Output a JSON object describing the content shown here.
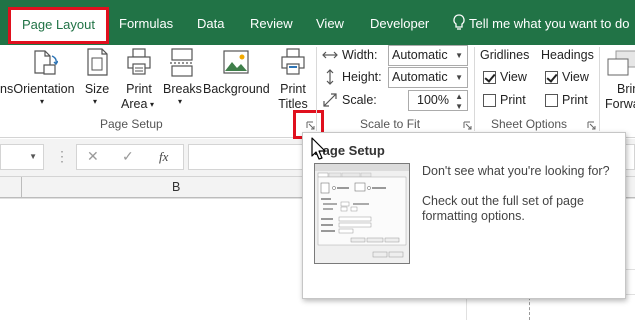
{
  "tabs": {
    "page_layout": "Page Layout",
    "formulas": "Formulas",
    "data": "Data",
    "review": "Review",
    "view": "View",
    "developer": "Developer",
    "tell_me": "Tell me what you want to do"
  },
  "ribbon": {
    "margins_partial": "ns",
    "orientation": "Orientation",
    "size": "Size",
    "print_area_line1": "Print",
    "print_area_line2": "Area",
    "breaks": "Breaks",
    "background": "Background",
    "print_titles_line1": "Print",
    "print_titles_line2": "Titles",
    "page_setup_group": "Page Setup",
    "width_label": "Width:",
    "width_value": "Automatic",
    "height_label": "Height:",
    "height_value": "Automatic",
    "scale_label": "Scale:",
    "scale_value": "100%",
    "scale_to_fit_group": "Scale to Fit",
    "gridlines_header": "Gridlines",
    "gridlines_view": "View",
    "gridlines_print": "Print",
    "headings_header": "Headings",
    "headings_view": "View",
    "headings_print": "Print",
    "sheet_options_group": "Sheet Options",
    "bring_forward_line1": "Brin",
    "bring_forward_line2": "Forwa"
  },
  "checkboxes": {
    "gridlines_view": true,
    "gridlines_print": false,
    "headings_view": true,
    "headings_print": false
  },
  "formula_bar": {
    "fx": "fx"
  },
  "columns": {
    "b": "B"
  },
  "tooltip": {
    "title": "Page Setup",
    "message1": "Don't see what you're looking for?",
    "message2": "Check out the full set of page formatting options."
  },
  "colors": {
    "excel_green": "#217346",
    "highlight_red": "#e0101e"
  }
}
